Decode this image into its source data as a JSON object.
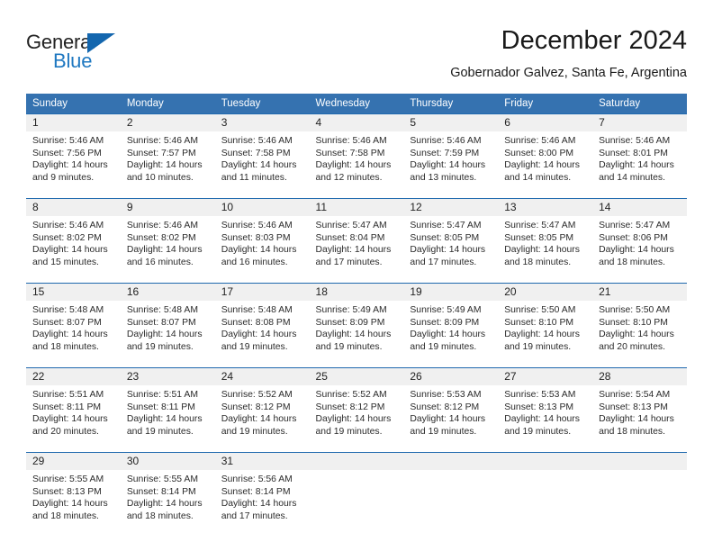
{
  "logo": {
    "text_primary": "General",
    "text_secondary": "Blue",
    "triangle_color": "#1366ae",
    "secondary_color": "#1f78c1"
  },
  "header": {
    "title": "December 2024",
    "subtitle": "Gobernador Galvez, Santa Fe, Argentina"
  },
  "theme": {
    "header_bg": "#3572b0",
    "cell_divider": "#1f69ae",
    "daynum_bg": "#f0f0f0"
  },
  "columns": [
    "Sunday",
    "Monday",
    "Tuesday",
    "Wednesday",
    "Thursday",
    "Friday",
    "Saturday"
  ],
  "weeks": [
    [
      {
        "day": "1",
        "sunrise": "Sunrise: 5:46 AM",
        "sunset": "Sunset: 7:56 PM",
        "daylight_line1": "Daylight: 14 hours",
        "daylight_line2": "and 9 minutes."
      },
      {
        "day": "2",
        "sunrise": "Sunrise: 5:46 AM",
        "sunset": "Sunset: 7:57 PM",
        "daylight_line1": "Daylight: 14 hours",
        "daylight_line2": "and 10 minutes."
      },
      {
        "day": "3",
        "sunrise": "Sunrise: 5:46 AM",
        "sunset": "Sunset: 7:58 PM",
        "daylight_line1": "Daylight: 14 hours",
        "daylight_line2": "and 11 minutes."
      },
      {
        "day": "4",
        "sunrise": "Sunrise: 5:46 AM",
        "sunset": "Sunset: 7:58 PM",
        "daylight_line1": "Daylight: 14 hours",
        "daylight_line2": "and 12 minutes."
      },
      {
        "day": "5",
        "sunrise": "Sunrise: 5:46 AM",
        "sunset": "Sunset: 7:59 PM",
        "daylight_line1": "Daylight: 14 hours",
        "daylight_line2": "and 13 minutes."
      },
      {
        "day": "6",
        "sunrise": "Sunrise: 5:46 AM",
        "sunset": "Sunset: 8:00 PM",
        "daylight_line1": "Daylight: 14 hours",
        "daylight_line2": "and 14 minutes."
      },
      {
        "day": "7",
        "sunrise": "Sunrise: 5:46 AM",
        "sunset": "Sunset: 8:01 PM",
        "daylight_line1": "Daylight: 14 hours",
        "daylight_line2": "and 14 minutes."
      }
    ],
    [
      {
        "day": "8",
        "sunrise": "Sunrise: 5:46 AM",
        "sunset": "Sunset: 8:02 PM",
        "daylight_line1": "Daylight: 14 hours",
        "daylight_line2": "and 15 minutes."
      },
      {
        "day": "9",
        "sunrise": "Sunrise: 5:46 AM",
        "sunset": "Sunset: 8:02 PM",
        "daylight_line1": "Daylight: 14 hours",
        "daylight_line2": "and 16 minutes."
      },
      {
        "day": "10",
        "sunrise": "Sunrise: 5:46 AM",
        "sunset": "Sunset: 8:03 PM",
        "daylight_line1": "Daylight: 14 hours",
        "daylight_line2": "and 16 minutes."
      },
      {
        "day": "11",
        "sunrise": "Sunrise: 5:47 AM",
        "sunset": "Sunset: 8:04 PM",
        "daylight_line1": "Daylight: 14 hours",
        "daylight_line2": "and 17 minutes."
      },
      {
        "day": "12",
        "sunrise": "Sunrise: 5:47 AM",
        "sunset": "Sunset: 8:05 PM",
        "daylight_line1": "Daylight: 14 hours",
        "daylight_line2": "and 17 minutes."
      },
      {
        "day": "13",
        "sunrise": "Sunrise: 5:47 AM",
        "sunset": "Sunset: 8:05 PM",
        "daylight_line1": "Daylight: 14 hours",
        "daylight_line2": "and 18 minutes."
      },
      {
        "day": "14",
        "sunrise": "Sunrise: 5:47 AM",
        "sunset": "Sunset: 8:06 PM",
        "daylight_line1": "Daylight: 14 hours",
        "daylight_line2": "and 18 minutes."
      }
    ],
    [
      {
        "day": "15",
        "sunrise": "Sunrise: 5:48 AM",
        "sunset": "Sunset: 8:07 PM",
        "daylight_line1": "Daylight: 14 hours",
        "daylight_line2": "and 18 minutes."
      },
      {
        "day": "16",
        "sunrise": "Sunrise: 5:48 AM",
        "sunset": "Sunset: 8:07 PM",
        "daylight_line1": "Daylight: 14 hours",
        "daylight_line2": "and 19 minutes."
      },
      {
        "day": "17",
        "sunrise": "Sunrise: 5:48 AM",
        "sunset": "Sunset: 8:08 PM",
        "daylight_line1": "Daylight: 14 hours",
        "daylight_line2": "and 19 minutes."
      },
      {
        "day": "18",
        "sunrise": "Sunrise: 5:49 AM",
        "sunset": "Sunset: 8:09 PM",
        "daylight_line1": "Daylight: 14 hours",
        "daylight_line2": "and 19 minutes."
      },
      {
        "day": "19",
        "sunrise": "Sunrise: 5:49 AM",
        "sunset": "Sunset: 8:09 PM",
        "daylight_line1": "Daylight: 14 hours",
        "daylight_line2": "and 19 minutes."
      },
      {
        "day": "20",
        "sunrise": "Sunrise: 5:50 AM",
        "sunset": "Sunset: 8:10 PM",
        "daylight_line1": "Daylight: 14 hours",
        "daylight_line2": "and 19 minutes."
      },
      {
        "day": "21",
        "sunrise": "Sunrise: 5:50 AM",
        "sunset": "Sunset: 8:10 PM",
        "daylight_line1": "Daylight: 14 hours",
        "daylight_line2": "and 20 minutes."
      }
    ],
    [
      {
        "day": "22",
        "sunrise": "Sunrise: 5:51 AM",
        "sunset": "Sunset: 8:11 PM",
        "daylight_line1": "Daylight: 14 hours",
        "daylight_line2": "and 20 minutes."
      },
      {
        "day": "23",
        "sunrise": "Sunrise: 5:51 AM",
        "sunset": "Sunset: 8:11 PM",
        "daylight_line1": "Daylight: 14 hours",
        "daylight_line2": "and 19 minutes."
      },
      {
        "day": "24",
        "sunrise": "Sunrise: 5:52 AM",
        "sunset": "Sunset: 8:12 PM",
        "daylight_line1": "Daylight: 14 hours",
        "daylight_line2": "and 19 minutes."
      },
      {
        "day": "25",
        "sunrise": "Sunrise: 5:52 AM",
        "sunset": "Sunset: 8:12 PM",
        "daylight_line1": "Daylight: 14 hours",
        "daylight_line2": "and 19 minutes."
      },
      {
        "day": "26",
        "sunrise": "Sunrise: 5:53 AM",
        "sunset": "Sunset: 8:12 PM",
        "daylight_line1": "Daylight: 14 hours",
        "daylight_line2": "and 19 minutes."
      },
      {
        "day": "27",
        "sunrise": "Sunrise: 5:53 AM",
        "sunset": "Sunset: 8:13 PM",
        "daylight_line1": "Daylight: 14 hours",
        "daylight_line2": "and 19 minutes."
      },
      {
        "day": "28",
        "sunrise": "Sunrise: 5:54 AM",
        "sunset": "Sunset: 8:13 PM",
        "daylight_line1": "Daylight: 14 hours",
        "daylight_line2": "and 18 minutes."
      }
    ],
    [
      {
        "day": "29",
        "sunrise": "Sunrise: 5:55 AM",
        "sunset": "Sunset: 8:13 PM",
        "daylight_line1": "Daylight: 14 hours",
        "daylight_line2": "and 18 minutes."
      },
      {
        "day": "30",
        "sunrise": "Sunrise: 5:55 AM",
        "sunset": "Sunset: 8:14 PM",
        "daylight_line1": "Daylight: 14 hours",
        "daylight_line2": "and 18 minutes."
      },
      {
        "day": "31",
        "sunrise": "Sunrise: 5:56 AM",
        "sunset": "Sunset: 8:14 PM",
        "daylight_line1": "Daylight: 14 hours",
        "daylight_line2": "and 17 minutes."
      },
      {
        "day": "",
        "sunrise": "",
        "sunset": "",
        "daylight_line1": "",
        "daylight_line2": ""
      },
      {
        "day": "",
        "sunrise": "",
        "sunset": "",
        "daylight_line1": "",
        "daylight_line2": ""
      },
      {
        "day": "",
        "sunrise": "",
        "sunset": "",
        "daylight_line1": "",
        "daylight_line2": ""
      },
      {
        "day": "",
        "sunrise": "",
        "sunset": "",
        "daylight_line1": "",
        "daylight_line2": ""
      }
    ]
  ]
}
